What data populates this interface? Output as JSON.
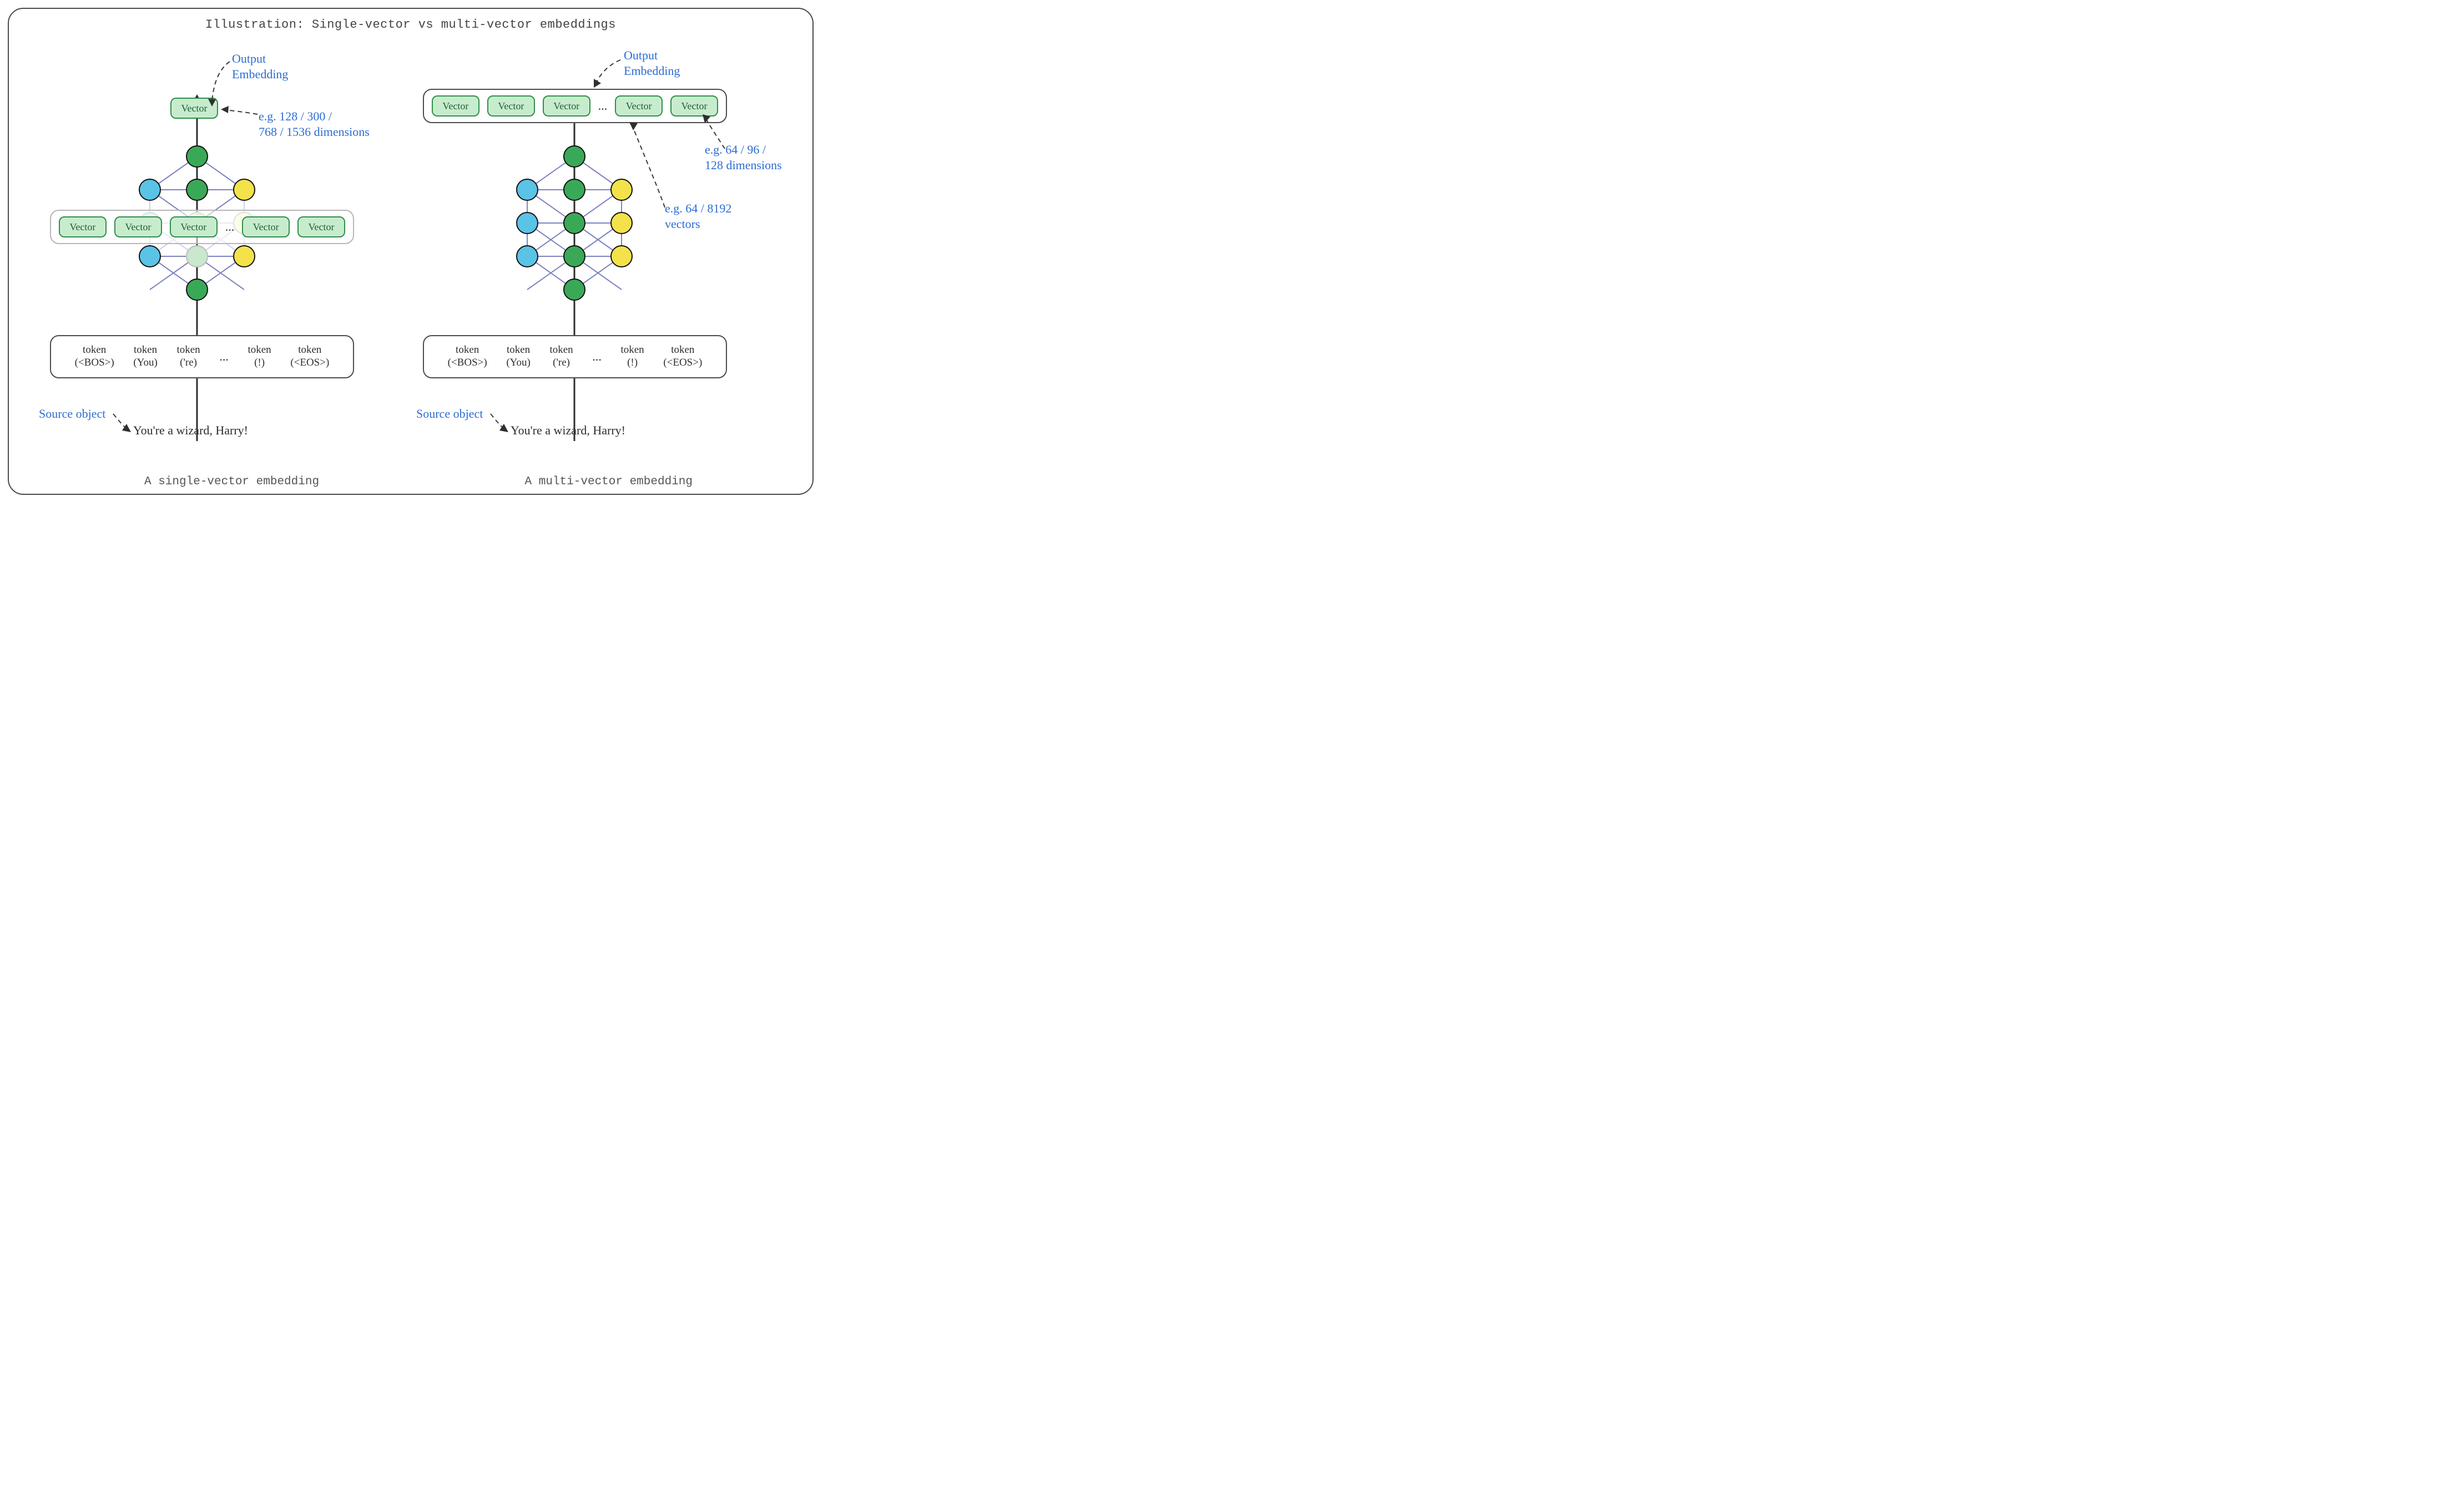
{
  "title": "Illustration: Single-vector vs multi-vector embeddings",
  "captions": {
    "left": "A single-vector embedding",
    "right": "A multi-vector embedding"
  },
  "annotations": {
    "output_embedding": "Output\nEmbedding",
    "single_dims": "e.g. 128 / 300 /\n768 / 1536 dimensions",
    "multi_dims": "e.g. 64 / 96 /\n128 dimensions",
    "multi_count": "e.g. 64 / 8192\nvectors",
    "source_label": "Source object",
    "source_text": "You're a wizard, Harry!"
  },
  "tokens": [
    "token\n(<BOS>)",
    "token\n(You)",
    "token\n('re)",
    "...",
    "token\n(!)",
    "token\n(<EOS>)"
  ],
  "vector_label": "Vector",
  "ellipsis": "..."
}
